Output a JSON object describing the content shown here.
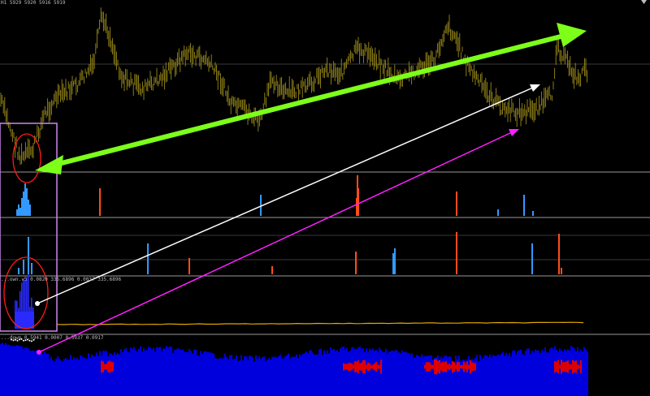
{
  "window": {
    "symbol_timeframe": "H1",
    "ohlc_text": "5929 5920 5916 5919"
  },
  "indicators": {
    "histogram_1": {
      "color_up": "#3399ff",
      "color_down": "#ff4d1a"
    },
    "histogram_2": {
      "color_up": "#3399ff",
      "color_down": "#ff4d1a"
    },
    "oscillator": {
      "label": "...own.v5 0.0820 335.6896 0.0037 335.6896",
      "line_color": "#e0a800"
    },
    "volume_pane": {
      "label": "...down 0.5941 0.0007 0.5937 0.0917",
      "bull_color": "#0000dd",
      "bear_color": "#dd0000"
    }
  },
  "annotations": {
    "trend_arrow_color": "#7dff1a",
    "white_arrow_color": "#ffffff",
    "magenta_arrow_color": "#ff20ff",
    "highlight_box_color": "#cc88ee",
    "circle_color": "#ff1a1a"
  },
  "colors": {
    "background": "#000000",
    "candle": "#9a8a1a",
    "grid": "#808080"
  }
}
